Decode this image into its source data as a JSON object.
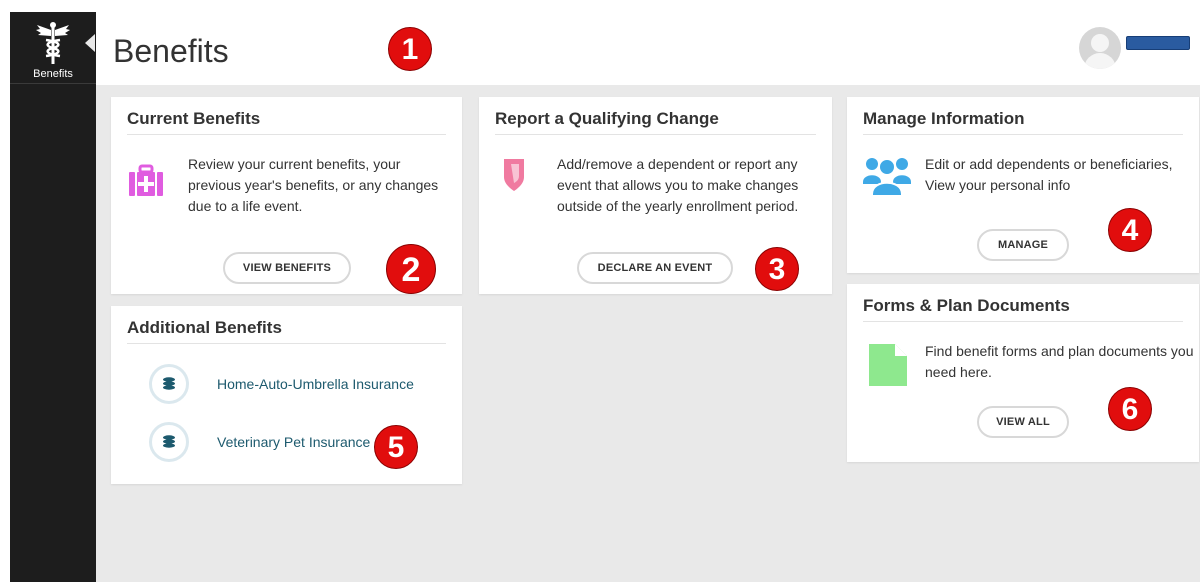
{
  "sidebar": {
    "app_label": "Benefits"
  },
  "header": {
    "title": "Benefits"
  },
  "markers": [
    "1",
    "2",
    "3",
    "4",
    "5",
    "6"
  ],
  "cards": {
    "current_benefits": {
      "title": "Current Benefits",
      "description": "Review your current benefits, your previous year's benefits, or any changes due to a life event.",
      "button": "VIEW BENEFITS",
      "icon": "first-aid-kit-icon",
      "icon_color": "#e05ce0"
    },
    "qualifying_change": {
      "title": "Report a Qualifying Change",
      "description": "Add/remove a dependent or report any event that allows you to make changes outside of the yearly enrollment period.",
      "button": "DECLARE AN EVENT",
      "icon": "shield-icon",
      "icon_color": "#f07aa0"
    },
    "manage_information": {
      "title": "Manage Information",
      "description": "Edit or add dependents or beneficiaries, View your personal info",
      "button": "MANAGE",
      "icon": "users-icon",
      "icon_color": "#3fa9e6"
    },
    "additional_benefits": {
      "title": "Additional Benefits",
      "items": [
        {
          "label": "Home-Auto-Umbrella Insurance",
          "icon": "coins-icon"
        },
        {
          "label": "Veterinary Pet Insurance",
          "icon": "coins-icon"
        }
      ]
    },
    "forms_documents": {
      "title": "Forms & Plan Documents",
      "description": "Find benefit forms and plan documents you need here.",
      "button": "VIEW ALL",
      "icon": "document-icon",
      "icon_color": "#8ee88e"
    }
  }
}
